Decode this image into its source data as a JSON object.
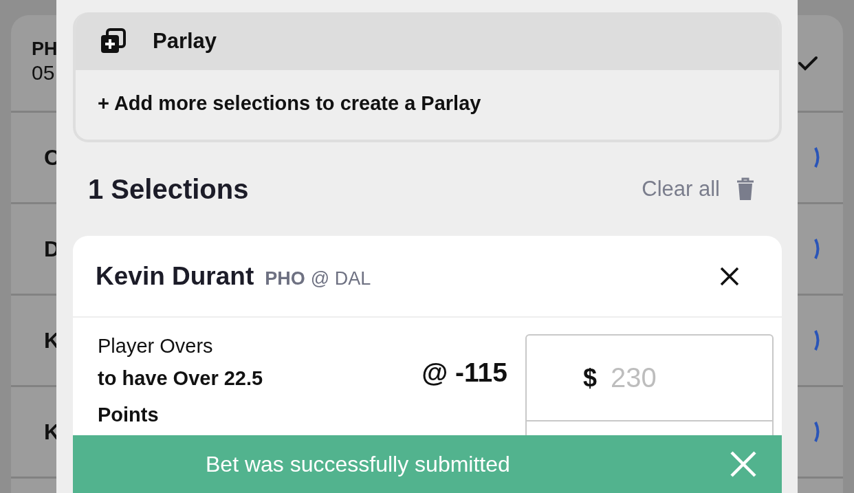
{
  "background_card": {
    "title": "PH",
    "subtitle": "05",
    "checked": true,
    "rows": [
      {
        "label": "C"
      },
      {
        "label": "D"
      },
      {
        "label": "K"
      },
      {
        "label": "K"
      }
    ]
  },
  "parlay": {
    "title": "Parlay",
    "message": "+ Add more selections to create a Parlay"
  },
  "selections": {
    "heading": "1 Selections",
    "clear_label": "Clear all"
  },
  "bets": [
    {
      "player": "Kevin Durant",
      "team": "PHO",
      "matchup": "@ DAL",
      "market": "Player Overs",
      "outcome": "to have Over 22.5 Points",
      "odds": "@ -115",
      "currency": "$",
      "stake_placeholder": "230"
    }
  ],
  "toast": {
    "message": "Bet was successfully submitted"
  }
}
